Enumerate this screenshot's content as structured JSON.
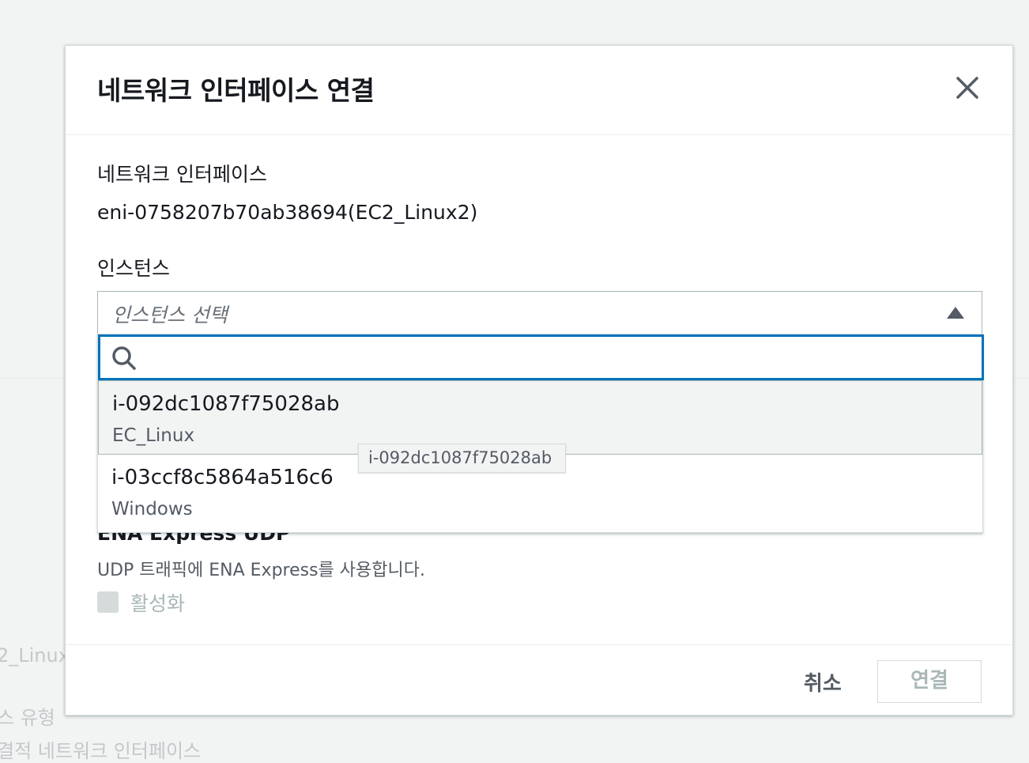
{
  "background": {
    "texts": [
      "2_Linux",
      "스 유형",
      "결적 네트워크 인터페이스"
    ]
  },
  "modal": {
    "title": "네트워크 인터페이스 연결",
    "network_interface": {
      "label": "네트워크 인터페이스",
      "value": "eni-0758207b70ab38694(EC2_Linux2)"
    },
    "instance": {
      "label": "인스턴스",
      "placeholder": "인스턴스 선택",
      "search_value": "",
      "options": [
        {
          "id": "i-092dc1087f75028ab",
          "name": "EC_Linux",
          "highlighted": true
        },
        {
          "id": "i-03ccf8c5864a516c6",
          "name": "Windows",
          "highlighted": false
        }
      ],
      "tooltip": "i-092dc1087f75028ab"
    },
    "ena_express_udp": {
      "title": "ENA Express UDP",
      "description": "UDP 트래픽에 ENA Express를 사용합니다.",
      "checkbox_label": "활성화",
      "checked": false,
      "disabled": true
    },
    "footer": {
      "cancel_label": "취소",
      "confirm_label": "연결"
    }
  },
  "colors": {
    "focus_border": "#0073bb",
    "disabled_text": "#aab7b8",
    "highlight_bg": "#f2f3f3"
  }
}
